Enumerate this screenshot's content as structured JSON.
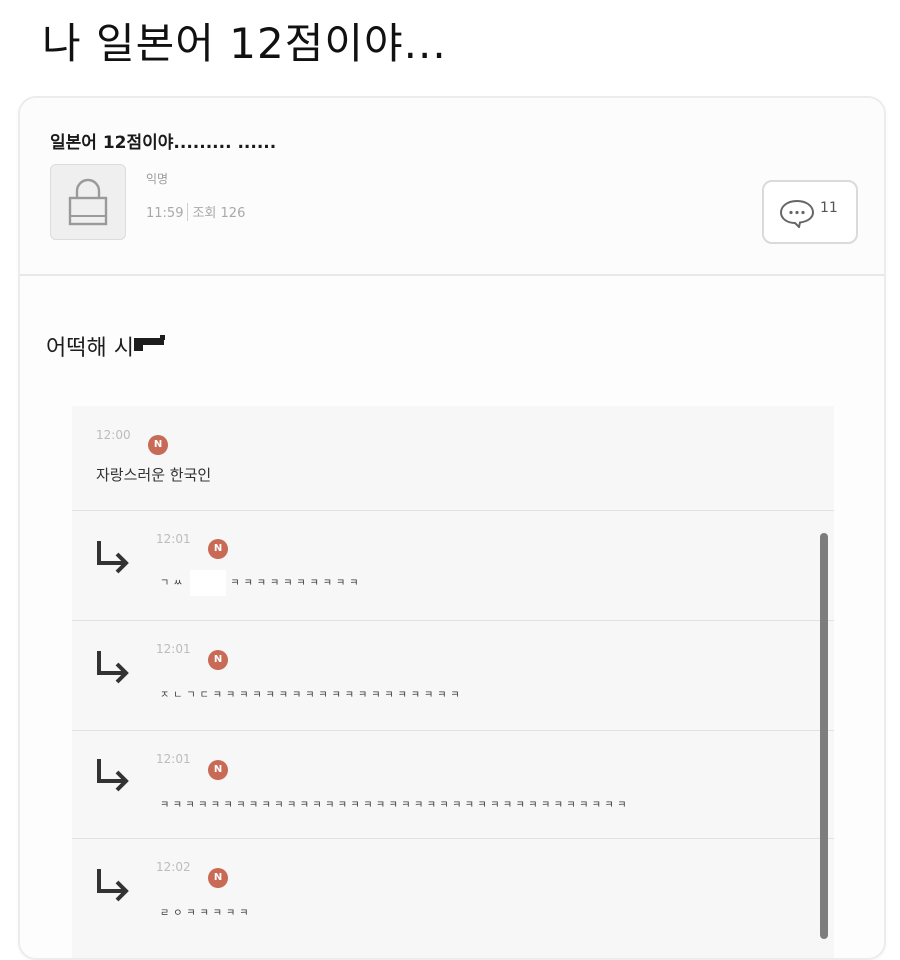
{
  "headline": "나 일본어 12점이야...",
  "post": {
    "title": "일본어 12점이야......... ......",
    "author": "익명",
    "time": "11:59",
    "views_label": "조회 126",
    "comment_count": "11",
    "body": "어떡해 시"
  },
  "comments": [
    {
      "time": "12:00",
      "badge": "N",
      "text": "자랑스러운 한국인",
      "reply": false
    },
    {
      "time": "12:01",
      "badge": "N",
      "text_before": "ㄱㅆ",
      "text": "ㅋㅋㅋㅋㅋㅋㅋㅋㅋㅋ",
      "reply": true
    },
    {
      "time": "12:01",
      "badge": "N",
      "text": "ㅈㄴㄱㄷㅋㅋㅋㅋㅋㅋㅋㅋㅋㅋㅋㅋㅋㅋㅋㅋㅋㅋㅋ",
      "reply": true
    },
    {
      "time": "12:01",
      "badge": "N",
      "text": "ㅋㅋㅋㅋㅋㅋㅋㅋㅋㅋㅋㅋㅋㅋㅋㅋㅋㅋㅋㅋㅋㅋㅋㅋㅋㅋㅋㅋㅋㅋㅋㅋㅋㅋㅋㅋㅋ",
      "reply": true
    },
    {
      "time": "12:02",
      "badge": "N",
      "text": "ㄹㅇㅋㅋㅋㅋㅋ",
      "reply": true
    }
  ],
  "icons": {
    "avatar": "lock-icon",
    "comment": "speech-bubble-icon",
    "reply": "reply-arrow-icon",
    "new_badge": "new-badge"
  },
  "colors": {
    "badge": "#c86a55",
    "scrollbar": "#7d7d7d"
  }
}
